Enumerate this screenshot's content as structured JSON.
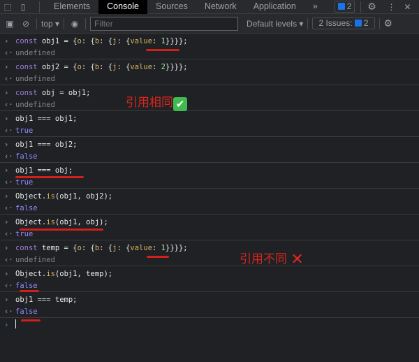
{
  "tabs": {
    "items": [
      "Elements",
      "Console",
      "Sources",
      "Network",
      "Application"
    ],
    "more": "»",
    "messages_count": "2"
  },
  "toolbar": {
    "context": "top",
    "filter_placeholder": "Filter",
    "levels": "Default levels",
    "issues_label": "2 Issues:",
    "issues_count": "2"
  },
  "entries": [
    {
      "input": [
        [
          "const ",
          "kw"
        ],
        [
          "obj1 = {",
          "plain"
        ],
        [
          "o",
          "prop"
        ],
        [
          ": {",
          "plain"
        ],
        [
          "b",
          "prop"
        ],
        [
          ": {",
          "plain"
        ],
        [
          "j",
          "prop"
        ],
        [
          ": {",
          "plain"
        ],
        [
          "value",
          "prop"
        ],
        [
          ": ",
          "plain"
        ],
        [
          "1",
          "num"
        ],
        [
          "}}}};",
          "plain"
        ]
      ],
      "output": [
        "undefined",
        "undef"
      ]
    },
    {
      "input": [
        [
          "const ",
          "kw"
        ],
        [
          "obj2 = {",
          "plain"
        ],
        [
          "o",
          "prop"
        ],
        [
          ": {",
          "plain"
        ],
        [
          "b",
          "prop"
        ],
        [
          ": {",
          "plain"
        ],
        [
          "j",
          "prop"
        ],
        [
          ": {",
          "plain"
        ],
        [
          "value",
          "prop"
        ],
        [
          ": ",
          "plain"
        ],
        [
          "2",
          "num"
        ],
        [
          "}}}};",
          "plain"
        ]
      ],
      "output": [
        "undefined",
        "undef"
      ]
    },
    {
      "input": [
        [
          "const ",
          "kw"
        ],
        [
          "obj = obj1;",
          "plain"
        ]
      ],
      "output": [
        "undefined",
        "undef"
      ]
    },
    {
      "input": [
        [
          "obj1 === obj1;",
          "plain"
        ]
      ],
      "output": [
        "true",
        "bool"
      ]
    },
    {
      "input": [
        [
          "obj1 === obj2;",
          "plain"
        ]
      ],
      "output": [
        "false",
        "bool"
      ]
    },
    {
      "input": [
        [
          "obj1 === obj;",
          "plain"
        ]
      ],
      "output": [
        "true",
        "bool"
      ]
    },
    {
      "input": [
        [
          "Object.",
          "plain"
        ],
        [
          "is",
          "fn"
        ],
        [
          "(obj1, obj2);",
          "plain"
        ]
      ],
      "output": [
        "false",
        "bool"
      ]
    },
    {
      "input": [
        [
          "Object.",
          "plain"
        ],
        [
          "is",
          "fn"
        ],
        [
          "(obj1, obj);",
          "plain"
        ]
      ],
      "output": [
        "true",
        "bool"
      ]
    },
    {
      "input": [
        [
          "const ",
          "kw"
        ],
        [
          "temp = {",
          "plain"
        ],
        [
          "o",
          "prop"
        ],
        [
          ": {",
          "plain"
        ],
        [
          "b",
          "prop"
        ],
        [
          ": {",
          "plain"
        ],
        [
          "j",
          "prop"
        ],
        [
          ": {",
          "plain"
        ],
        [
          "value",
          "prop"
        ],
        [
          ": ",
          "plain"
        ],
        [
          "1",
          "num"
        ],
        [
          "}}}};",
          "plain"
        ]
      ],
      "output": [
        "undefined",
        "undef"
      ]
    },
    {
      "input": [
        [
          "Object.",
          "plain"
        ],
        [
          "is",
          "fn"
        ],
        [
          "(obj1, temp);",
          "plain"
        ]
      ],
      "output": [
        "false",
        "bool"
      ]
    },
    {
      "input": [
        [
          "obj1 === temp;",
          "plain"
        ]
      ],
      "output": [
        "false",
        "bool"
      ]
    }
  ],
  "annotations": {
    "same_ref": "引用相同",
    "diff_ref": "引用不同"
  }
}
